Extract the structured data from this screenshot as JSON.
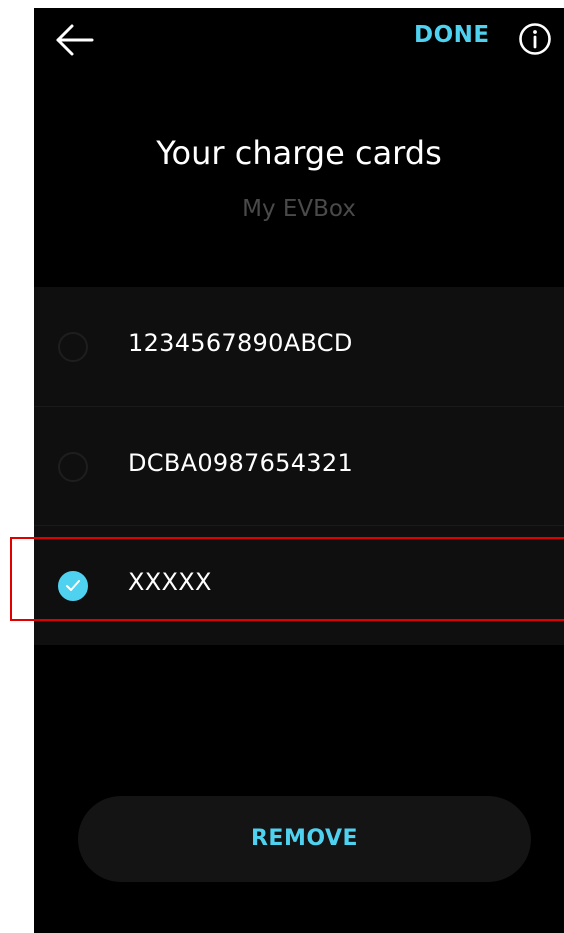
{
  "header": {
    "back_icon": "arrow-left-icon",
    "done_label": "DONE",
    "info_icon": "info-circle-icon"
  },
  "title": "Your charge cards",
  "subtitle": "My EVBox",
  "cards": [
    {
      "label": "1234567890ABCD",
      "selected": false
    },
    {
      "label": "DCBA0987654321",
      "selected": false
    },
    {
      "label": "XXXXX",
      "selected": true
    }
  ],
  "remove_label": "REMOVE",
  "colors": {
    "accent": "#4fd1f0",
    "background": "#000000",
    "list_background": "#0f0f0f",
    "highlight": "#e00000"
  }
}
